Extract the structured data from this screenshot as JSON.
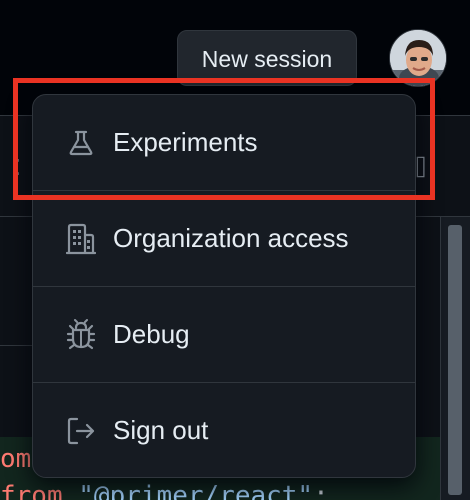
{
  "header": {
    "new_session_label": "New session"
  },
  "menu": {
    "items": [
      {
        "label": "Experiments",
        "icon": "beaker-icon"
      },
      {
        "label": "Organization access",
        "icon": "organization-icon"
      },
      {
        "label": "Debug",
        "icon": "bug-icon"
      },
      {
        "label": "Sign out",
        "icon": "sign-out-icon"
      }
    ]
  },
  "code": {
    "line1_kw": "om",
    "line2_kw": "from",
    "line2_str": "\"@primer/react\"",
    "line2_punc": ";"
  },
  "colors": {
    "background": "#010409",
    "menu_bg": "#161b22",
    "menu_border": "#30363d",
    "text": "#e6edf3",
    "icon": "#8b949e",
    "highlight": "#ea3323"
  }
}
